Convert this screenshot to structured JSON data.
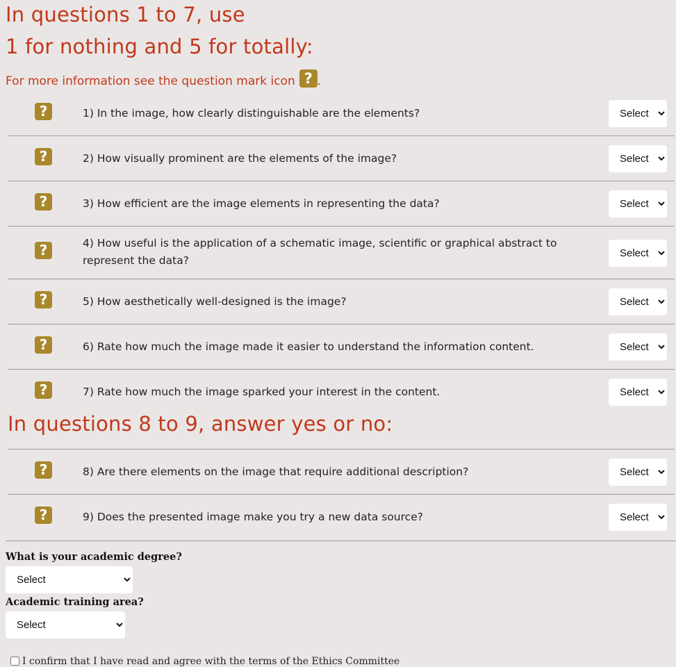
{
  "header": {
    "line1": "In questions 1 to 7, use",
    "line2": "1 for nothing and 5 for totally:",
    "info_text": "For more information see the question mark icon",
    "info_suffix": "."
  },
  "help_icon_glyph": "?",
  "section2_title": "In questions 8 to 9, answer yes or no:",
  "select_placeholder": "Select",
  "questions": [
    {
      "text": "1) In the image, how clearly distinguishable are the elements?"
    },
    {
      "text": "2) How visually prominent are the elements of the image?"
    },
    {
      "text": "3) How efficient are the image elements in representing the data?"
    },
    {
      "text": "4) How useful is the application of a schematic image, scientific or graphical abstract to represent the data?"
    },
    {
      "text": "5) How aesthetically well-designed is the image?"
    },
    {
      "text": "6) Rate how much the image made it easier to understand the information content."
    },
    {
      "text": "7) Rate how much the image sparked your interest in the content."
    },
    {
      "text": "8) Are there elements on the image that require additional description?"
    },
    {
      "text": "9) Does the presented image make you try a new data source?"
    }
  ],
  "profile": {
    "degree_label": "What is your academic degree?",
    "degree_value": "Select",
    "area_label": "Academic training area?",
    "area_value": "Select"
  },
  "consent_text": "I confirm that I have read and agree with the terms of the Ethics Committee",
  "colors": {
    "heading": "#c0391b",
    "help_icon": "#a8882b",
    "background": "#ebe6e6"
  }
}
